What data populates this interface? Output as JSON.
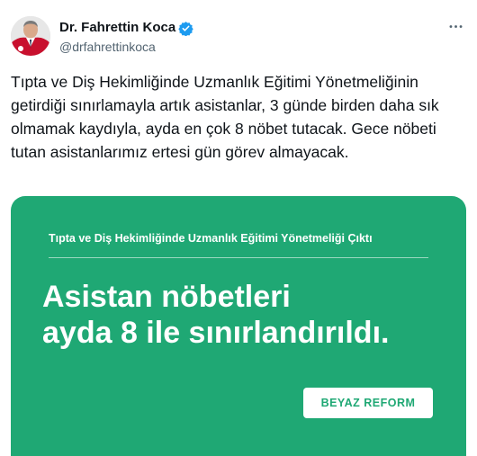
{
  "tweet": {
    "author_name": "Dr. Fahrettin Koca",
    "author_handle": "@drfahrettinkoca",
    "verified_icon": "verified-badge-icon",
    "more_icon": "more-horizontal-icon",
    "text": "Tıpta ve Diş Hekimliğinde Uzmanlık Eğitimi Yönetmeliğinin getirdiği sınırlamayla artık asistanlar, 3 günde birden daha sık olmamak kaydıyla, ayda en çok 8 nöbet tutacak. Gece nöbeti tutan asistanlarımız ertesi gün görev almayacak."
  },
  "card": {
    "subtitle": "Tıpta ve Diş Hekimliğinde Uzmanlık Eğitimi Yönetmeliği Çıktı",
    "headline_line1": "Asistan nöbetleri",
    "headline_line2": "ayda 8 ile sınırlandırıldı.",
    "brand": "BEYAZ REFORM"
  },
  "colors": {
    "card_green": "#1fa874",
    "verified_blue": "#1d9bf0",
    "text": "#0f1419",
    "secondary_text": "#536471"
  }
}
